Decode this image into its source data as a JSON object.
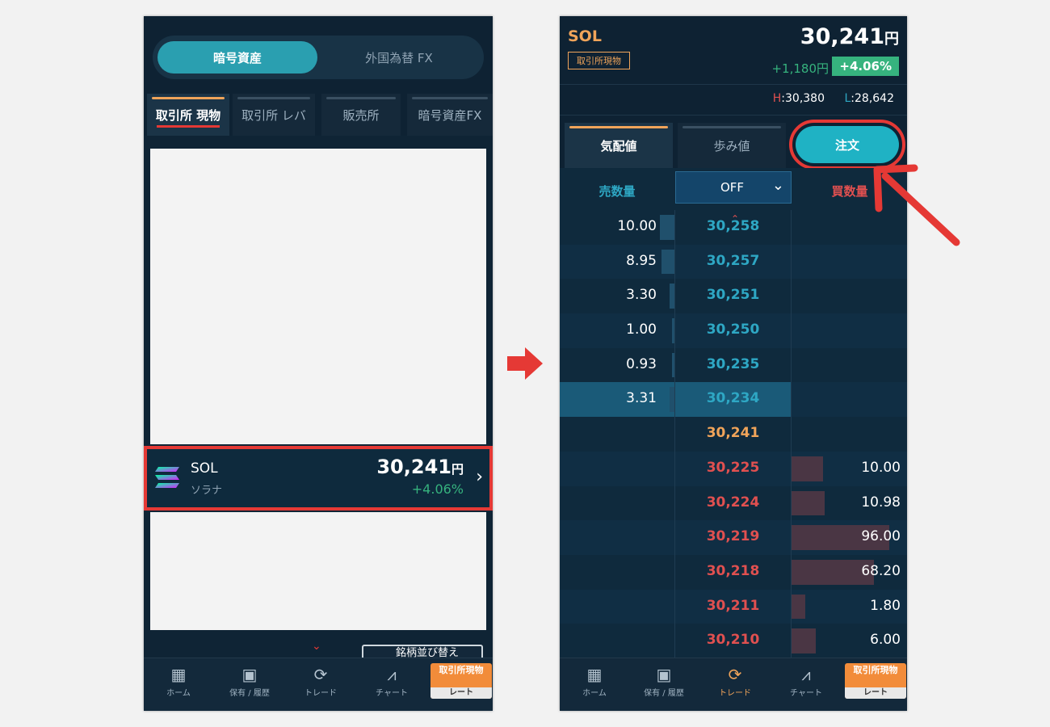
{
  "left": {
    "segment": [
      "暗号資産",
      "外国為替 FX"
    ],
    "market_tabs": [
      "取引所 現物",
      "取引所 レバ",
      "販売所",
      "暗号資産FX"
    ],
    "sol_row": {
      "symbol": "SOL",
      "name": "ソラナ",
      "price": "30,241",
      "unit": "円",
      "change": "+4.06%"
    },
    "sort_button": "銘柄並び替え"
  },
  "right": {
    "symbol": "SOL",
    "market_badge": "取引所現物",
    "price": "30,241",
    "unit": "円",
    "change_abs": "+1,180円",
    "change_pct": "+4.06%",
    "high_label": "H",
    "high_value": ":30,380",
    "low_label": "L",
    "low_value": ":28,642",
    "tabs": [
      "気配値",
      "歩み値"
    ],
    "order_button": "注文",
    "col_sell": "売数量",
    "col_buy": "買数量",
    "select_value": "OFF",
    "asks": [
      {
        "qty": "10.00",
        "price": "30,258"
      },
      {
        "qty": "8.95",
        "price": "30,257"
      },
      {
        "qty": "3.30",
        "price": "30,251"
      },
      {
        "qty": "1.00",
        "price": "30,250"
      },
      {
        "qty": "0.93",
        "price": "30,235"
      },
      {
        "qty": "3.31",
        "price": "30,234"
      }
    ],
    "last": "30,241",
    "bids": [
      {
        "qty": "10.00",
        "price": "30,225"
      },
      {
        "qty": "10.98",
        "price": "30,224"
      },
      {
        "qty": "96.00",
        "price": "30,219"
      },
      {
        "qty": "68.20",
        "price": "30,218"
      },
      {
        "qty": "1.80",
        "price": "30,211"
      },
      {
        "qty": "6.00",
        "price": "30,210"
      }
    ]
  },
  "nav": {
    "items": [
      "ホーム",
      "保有 / 履歴",
      "トレード",
      "チャート"
    ],
    "badge_top": "取引所現物",
    "badge_bottom": "レート"
  },
  "colors": {
    "accent": "#f0a45a",
    "ask": "#2ea7c4",
    "bid": "#e05050",
    "highlight": "#e53935",
    "up": "#36b37e"
  }
}
